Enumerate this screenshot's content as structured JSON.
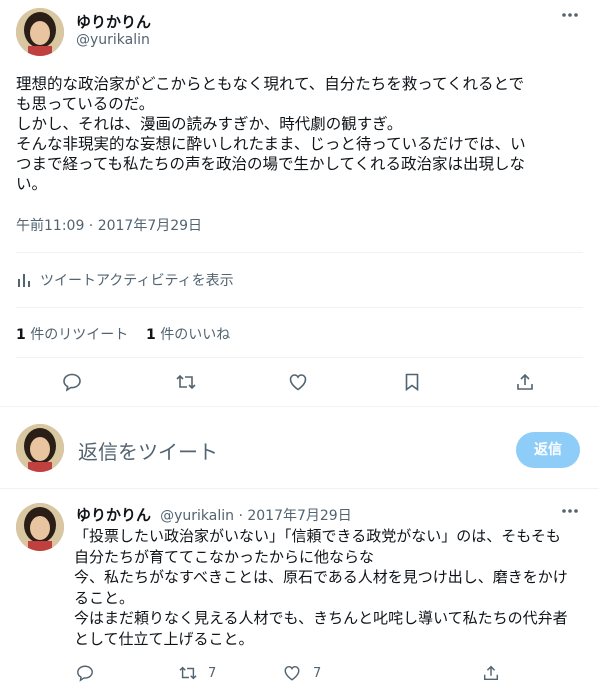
{
  "tweet": {
    "display_name": "ゆりかりん",
    "handle": "@yurikalin",
    "more_icon": "…",
    "lines": [
      "理想的な政治家がどこからともなく現れて、自分たちを救ってくれるとで",
      "も思っているのだ。",
      "しかし、それは、漫画の読みすぎか、時代劇の観すぎ。",
      "そんな非現実的な妄想に酔いしれたまま、じっと待っているだけでは、い",
      "つまで経っても私たちの声を政治の場で生かしてくれる政治家は出現しな",
      "い。"
    ],
    "timestamp": "午前11:09 · 2017年7月29日",
    "analytics_label": "ツイートアクティビティを表示",
    "retweet_count": "1",
    "retweet_label": "件のリツイート",
    "like_count": "1",
    "like_label": "件のいいね"
  },
  "reply_box": {
    "placeholder": "返信をツイート",
    "button_label": "返信"
  },
  "reply_tweet": {
    "display_name": "ゆりかりん",
    "meta": "@yurikalin · 2017年7月29日",
    "lines": [
      "「投票したい政治家がいない」「信頼できる政党がない」のは、そもそも",
      "自分たちが育ててこなかったからに他ならな",
      "今、私たちがなすべきことは、原石である人材を見つけ出し、磨きをかけ",
      "ること。",
      "今はまだ頼りなく見える人材でも、きちんと叱咤し導いて私たちの代弁者",
      "として仕立て上げること。"
    ],
    "retweet_count": "7",
    "like_count": "7"
  },
  "icons": [
    "reply-icon",
    "retweet-icon",
    "like-icon",
    "bookmark-icon",
    "share-icon",
    "analytics-icon",
    "more-icon"
  ]
}
